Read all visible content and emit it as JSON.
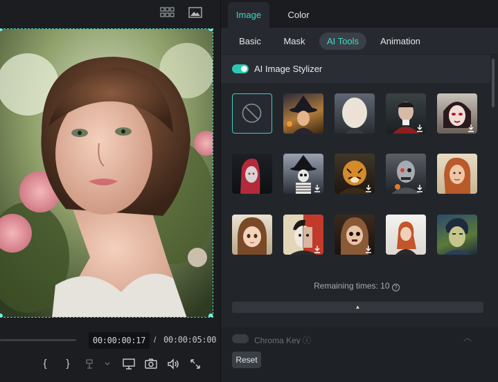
{
  "preview": {
    "timecode_current": "00:00:00:17",
    "timecode_separator": "/",
    "timecode_total": "00:00:05:00",
    "controls": {
      "mark_in": "{",
      "mark_out": "}"
    },
    "scrub_progress": 0.35,
    "icons": [
      "grid-icon",
      "image-icon",
      "split-icon",
      "display-icon",
      "camera-icon",
      "volume-icon",
      "fullscreen-icon"
    ]
  },
  "panel": {
    "tabs": [
      {
        "label": "Image",
        "active": true
      },
      {
        "label": "Color",
        "active": false
      }
    ],
    "subtabs": [
      {
        "label": "Basic",
        "active": false
      },
      {
        "label": "Mask",
        "active": false
      },
      {
        "label": "AI Tools",
        "active": true
      },
      {
        "label": "Animation",
        "active": false
      }
    ],
    "stylizer": {
      "label": "AI Image Stylizer",
      "enabled": true
    },
    "styles": [
      {
        "name": "none",
        "download": false
      },
      {
        "name": "witch",
        "download": false
      },
      {
        "name": "pale-lady",
        "download": false
      },
      {
        "name": "zombie-man",
        "download": true
      },
      {
        "name": "vampire-elf",
        "download": true
      },
      {
        "name": "red-hair-ghost",
        "download": false
      },
      {
        "name": "skeleton-witch",
        "download": true
      },
      {
        "name": "tiger-warrior",
        "download": true
      },
      {
        "name": "cyborg",
        "download": true
      },
      {
        "name": "painted-portrait",
        "download": false
      },
      {
        "name": "anime-girl",
        "download": false
      },
      {
        "name": "pop-art",
        "download": true
      },
      {
        "name": "doll",
        "download": true
      },
      {
        "name": "watercolor",
        "download": false
      },
      {
        "name": "van-gogh",
        "download": false
      }
    ],
    "remaining": "Remaining times: 10",
    "chroma_label": "Chroma Key",
    "reset_label": "Reset",
    "accent": "#3fd7c2"
  }
}
